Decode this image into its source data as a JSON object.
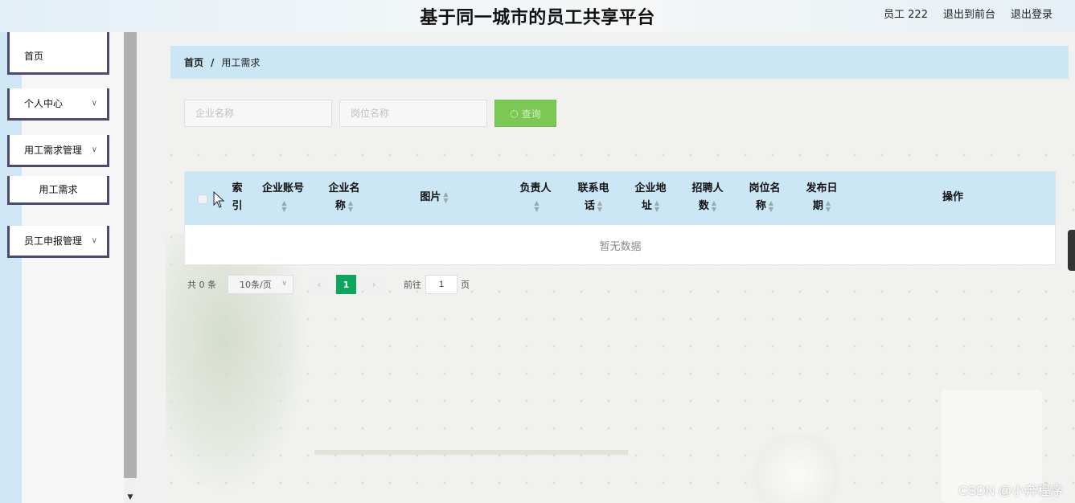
{
  "header": {
    "title": "基于同一城市的员工共享平台",
    "user": "员工 222",
    "to_front": "退出到前台",
    "logout": "退出登录"
  },
  "sidebar": {
    "items": [
      {
        "label": "首页"
      },
      {
        "label": "个人中心"
      },
      {
        "label": "用工需求管理"
      },
      {
        "label": "用工需求"
      },
      {
        "label": "员工申报管理"
      }
    ]
  },
  "breadcrumb": {
    "home": "首页",
    "separator": "/",
    "current": "用工需求"
  },
  "search": {
    "company_placeholder": "企业名称",
    "position_placeholder": "岗位名称",
    "button_label": "查询"
  },
  "table": {
    "columns": [
      {
        "line1": "索",
        "line2": "引"
      },
      {
        "line1": "企业账号",
        "line2": ""
      },
      {
        "line1": "企业名",
        "line2": "称"
      },
      {
        "line1": "图片",
        "line2": ""
      },
      {
        "line1": "负责人",
        "line2": ""
      },
      {
        "line1": "联系电",
        "line2": "话"
      },
      {
        "line1": "企业地",
        "line2": "址"
      },
      {
        "line1": "招聘人",
        "line2": "数"
      },
      {
        "line1": "岗位名",
        "line2": "称"
      },
      {
        "line1": "发布日",
        "line2": "期"
      },
      {
        "line1": "操作",
        "line2": ""
      }
    ],
    "empty_text": "暂无数据"
  },
  "pagination": {
    "total": "共 0 条",
    "page_size": "10条/页",
    "current_page": "1",
    "goto_prefix": "前往",
    "goto_value": "1",
    "goto_suffix": "页"
  },
  "watermark": "CSDN @小奔程序",
  "colors": {
    "accent_green": "#67c23a",
    "active_page": "#0ea65d",
    "header_blue": "#cbe6f4",
    "menu_border": "#4c4a73"
  }
}
